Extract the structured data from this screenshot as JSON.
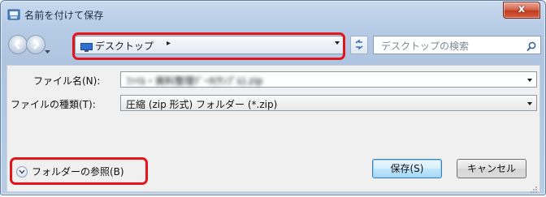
{
  "window": {
    "title": "名前を付けて保存",
    "close_label": "x",
    "app_icon": "save-dialog-icon"
  },
  "toolbar": {
    "back_icon": "back-arrow-icon",
    "forward_icon": "forward-arrow-icon",
    "address_path": "デスクトップ",
    "address_chevron": "▸",
    "refresh_icon": "refresh-icon",
    "search_placeholder": "デスクトップの検索"
  },
  "form": {
    "filename_label": "ファイル名(N):",
    "filename_value": "ﾌｧｲﾙ・資料整理ﾃﾞｰﾀ(ｻﾝﾌﾟﾙ).zip",
    "filetype_label": "ファイルの種類(T):",
    "filetype_value": "圧縮 (zip 形式) フォルダー (*.zip)"
  },
  "footer": {
    "browse_label": "フォルダーの参照(B)",
    "save_label": "保存(S)",
    "cancel_label": "キャンセル"
  },
  "colors": {
    "highlight": "#e3151b",
    "window_frame": "#aec4e0",
    "close_button": "#c23b22",
    "default_button": "#3c7fb1"
  }
}
